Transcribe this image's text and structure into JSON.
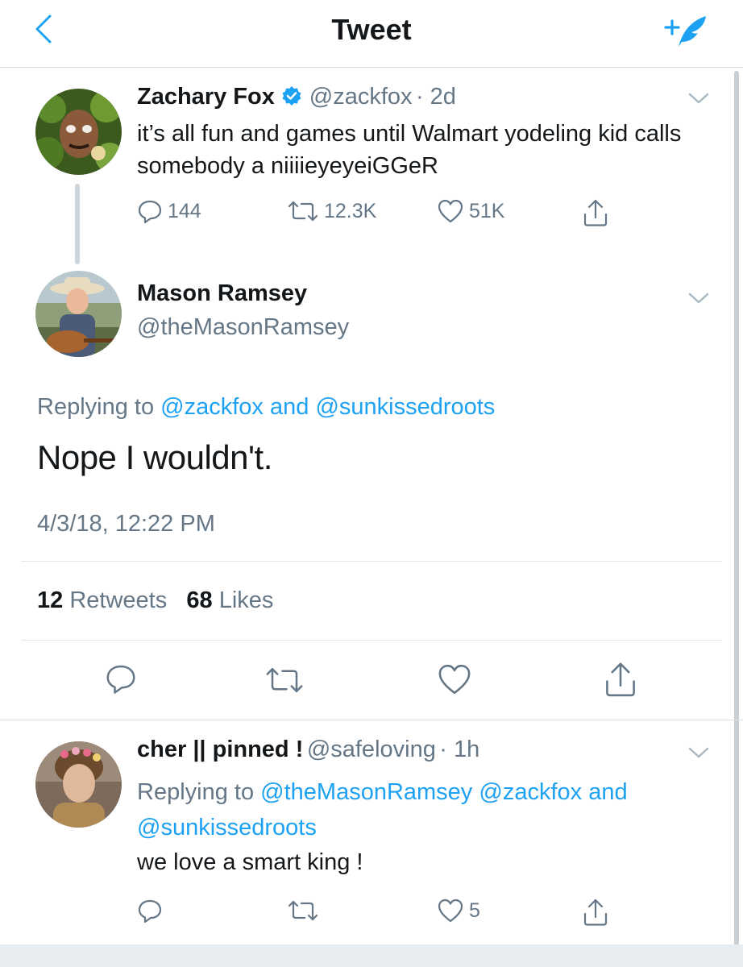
{
  "header": {
    "title": "Tweet",
    "back_icon": "chevron-left-icon",
    "compose_icon": "compose-feather-icon"
  },
  "colors": {
    "accent": "#1da1f2",
    "text": "#14171a",
    "muted": "#657786",
    "divider": "#e1e8ed"
  },
  "parent_tweet": {
    "name": "Zachary Fox",
    "verified": true,
    "handle": "@zackfox",
    "age": "· 2d",
    "text": "it’s all fun and games until Walmart yodeling kid calls somebody a niiiieyeyeiGGeR",
    "replies": "144",
    "retweets": "12.3K",
    "likes": "51K"
  },
  "main_tweet": {
    "name": "Mason Ramsey",
    "handle": "@theMasonRamsey",
    "replying_prefix": "Replying to",
    "replying_user1": "@zackfox",
    "replying_and": "and",
    "replying_user2": "@sunkissedroots",
    "text": "Nope I wouldn't.",
    "timestamp": "4/3/18, 12:22 PM",
    "retweet_count": "12",
    "retweet_label": "Retweets",
    "like_count": "68",
    "like_label": "Likes"
  },
  "reply_tweet": {
    "name": "cher || pinned !",
    "handle": "@safeloving",
    "age": "· 1h",
    "replying_prefix": "Replying to",
    "replying_user1": "@theMasonRamsey",
    "replying_user2": "@zackfox",
    "replying_and": "and",
    "replying_user3": "@sunkissedroots",
    "text": "we love a smart king !",
    "likes": "5"
  }
}
